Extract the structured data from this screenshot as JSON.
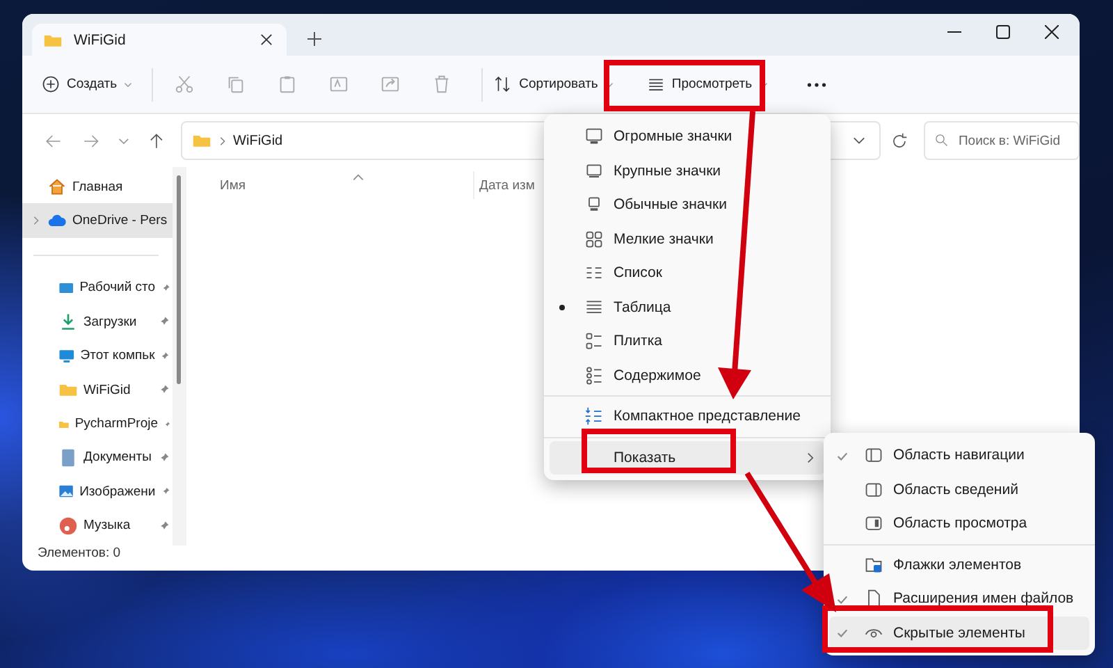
{
  "window": {
    "tab_title": "WiFiGid"
  },
  "toolbar": {
    "new_button": "Создать",
    "sort_button": "Сортировать",
    "view_button": "Просмотреть"
  },
  "address_bar": {
    "path": "WiFiGid",
    "search": {
      "placeholder": "Поиск в: WiFiGid"
    }
  },
  "columns": [
    "Имя",
    "Дата изм"
  ],
  "sidebar": {
    "items": [
      {
        "label": "Главная",
        "selected": false,
        "expandable": false
      },
      {
        "label": "OneDrive - Pers",
        "selected": true,
        "expandable": true
      }
    ],
    "pinned_items": [
      {
        "label": "Рабочий сто",
        "pinned": true
      },
      {
        "label": "Загрузки",
        "pinned": true
      },
      {
        "label": "Этот компьк",
        "pinned": true
      },
      {
        "label": "WiFiGid",
        "pinned": true
      },
      {
        "label": "PycharmProje",
        "pinned": true
      },
      {
        "label": "Документы",
        "pinned": true
      },
      {
        "label": "Изображени",
        "pinned": true
      },
      {
        "label": "Музыка",
        "pinned": true
      }
    ]
  },
  "status_bar": "Элементов: 0",
  "view_menu": {
    "layouts": [
      {
        "label": "Огромные значки",
        "selected": false
      },
      {
        "label": "Крупные значки",
        "selected": false
      },
      {
        "label": "Обычные значки",
        "selected": false
      },
      {
        "label": "Мелкие значки",
        "selected": false
      },
      {
        "label": "Список",
        "selected": false
      },
      {
        "label": "Таблица",
        "selected": true
      },
      {
        "label": "Плитка",
        "selected": false
      },
      {
        "label": "Содержимое",
        "selected": false
      }
    ],
    "compact": {
      "label": "Компактное представление"
    },
    "show": {
      "label": "Показать",
      "selected": true
    }
  },
  "show_menu": {
    "items": [
      {
        "label": "Область навигации",
        "checked": true,
        "divider_above": false,
        "selected": false
      },
      {
        "label": "Область сведений",
        "checked": false,
        "divider_above": false,
        "selected": false
      },
      {
        "label": "Область просмотра",
        "checked": false,
        "divider_above": false,
        "selected": false
      },
      {
        "label": "Флажки элементов",
        "checked": false,
        "divider_above": true,
        "selected": false
      },
      {
        "label": "Расширения имен файлов",
        "checked": true,
        "divider_above": false,
        "selected": false
      },
      {
        "label": "Скрытые элементы",
        "checked": true,
        "divider_above": false,
        "selected": true
      }
    ]
  }
}
